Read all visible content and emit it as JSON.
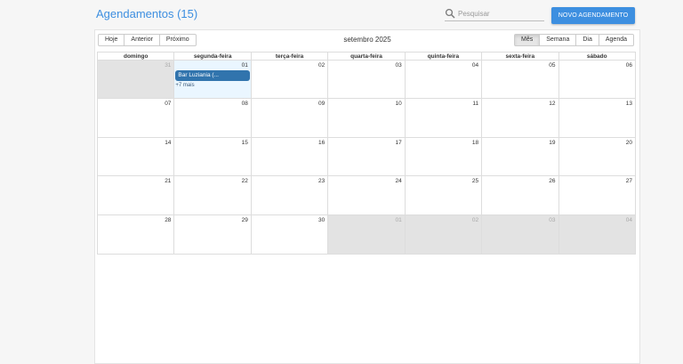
{
  "header": {
    "title": "Agendamentos (15)",
    "search_placeholder": "Pesquisar",
    "new_button": "NOVO AGENDAMENTO"
  },
  "toolbar": {
    "today": "Hoje",
    "prev": "Anterior",
    "next": "Próximo",
    "month_label": "setembro 2025",
    "views": {
      "month": "Mês",
      "week": "Semana",
      "day": "Dia",
      "agenda": "Agenda"
    },
    "active_view": "month"
  },
  "calendar": {
    "weekdays": [
      "domingo",
      "segunda-feira",
      "terça-feira",
      "quarta-feira",
      "quinta-feira",
      "sexta-feira",
      "sábado"
    ],
    "weeks": [
      [
        {
          "d": "31",
          "off": true
        },
        {
          "d": "01",
          "today": true
        },
        {
          "d": "02"
        },
        {
          "d": "03"
        },
        {
          "d": "04"
        },
        {
          "d": "05"
        },
        {
          "d": "06"
        }
      ],
      [
        {
          "d": "07"
        },
        {
          "d": "08"
        },
        {
          "d": "09"
        },
        {
          "d": "10"
        },
        {
          "d": "11"
        },
        {
          "d": "12"
        },
        {
          "d": "13"
        }
      ],
      [
        {
          "d": "14"
        },
        {
          "d": "15"
        },
        {
          "d": "16"
        },
        {
          "d": "17"
        },
        {
          "d": "18"
        },
        {
          "d": "19"
        },
        {
          "d": "20"
        }
      ],
      [
        {
          "d": "21"
        },
        {
          "d": "22"
        },
        {
          "d": "23"
        },
        {
          "d": "24"
        },
        {
          "d": "25"
        },
        {
          "d": "26"
        },
        {
          "d": "27"
        }
      ],
      [
        {
          "d": "28"
        },
        {
          "d": "29"
        },
        {
          "d": "30"
        },
        {
          "d": "01",
          "off": true
        },
        {
          "d": "02",
          "off": true
        },
        {
          "d": "03",
          "off": true
        },
        {
          "d": "04",
          "off": true
        }
      ]
    ],
    "events": [
      {
        "week": 0,
        "day": 1,
        "title": "Bar Luziania (...",
        "more": "+7 mais"
      }
    ]
  },
  "colors": {
    "accent": "#3d8fe0",
    "event": "#3174ad",
    "today_bg": "#eaf6ff",
    "off_range_bg": "#e3e3e3"
  }
}
